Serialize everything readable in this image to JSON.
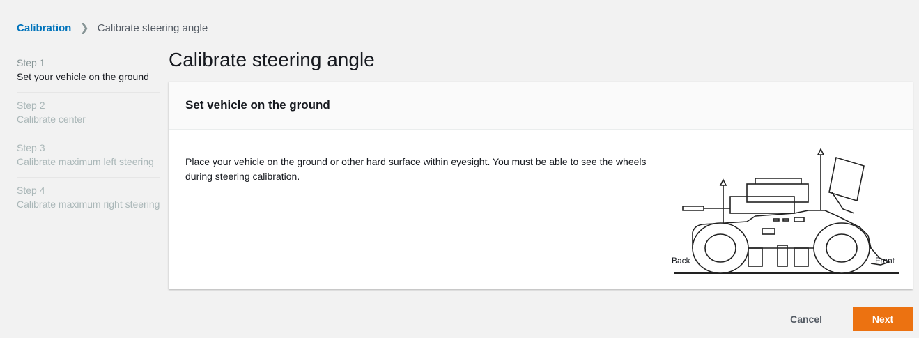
{
  "breadcrumb": {
    "root": "Calibration",
    "current": "Calibrate steering angle"
  },
  "steps": [
    {
      "num": "Step 1",
      "title": "Set your vehicle on the ground"
    },
    {
      "num": "Step 2",
      "title": "Calibrate center"
    },
    {
      "num": "Step 3",
      "title": "Calibrate maximum left steering"
    },
    {
      "num": "Step 4",
      "title": "Calibrate maximum right steering"
    }
  ],
  "page": {
    "title": "Calibrate steering angle"
  },
  "panel": {
    "header": "Set vehicle on the ground",
    "description": "Place your vehicle on the ground or other hard surface within eyesight. You must be able to see the wheels during steering calibration.",
    "diagram": {
      "back_label": "Back",
      "front_label": "Front"
    }
  },
  "footer": {
    "cancel_label": "Cancel",
    "next_label": "Next"
  },
  "colors": {
    "accent": "#ec7211",
    "link": "#0073bb"
  }
}
